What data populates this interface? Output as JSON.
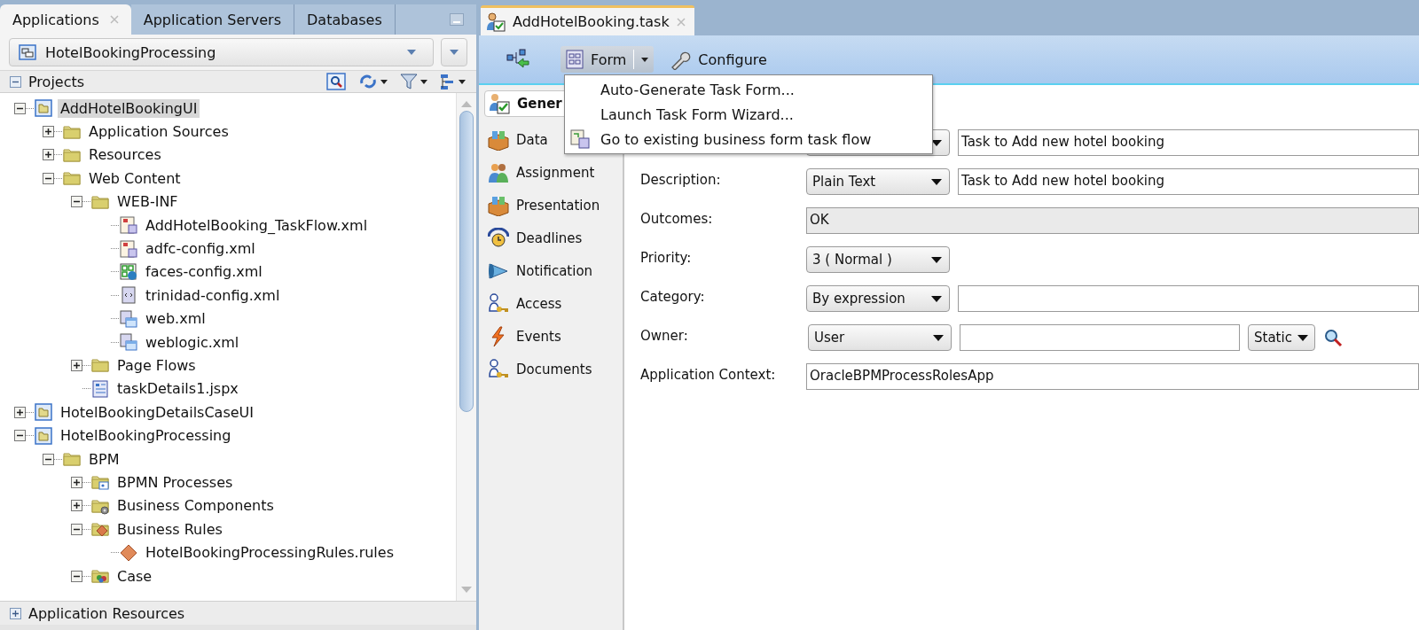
{
  "left_panel": {
    "tabs": [
      {
        "label": "Applications",
        "selected": true,
        "closable": true
      },
      {
        "label": "Application Servers",
        "selected": false,
        "closable": false
      },
      {
        "label": "Databases",
        "selected": false,
        "closable": false
      }
    ],
    "application_selector": {
      "value": "HotelBookingProcessing"
    },
    "projects_header": {
      "title": "Projects",
      "expanded": true
    },
    "tree": [
      {
        "label": "AddHotelBookingUI",
        "kind": "project",
        "expanded": true,
        "selected": true,
        "children": [
          {
            "label": "Application Sources",
            "kind": "folder",
            "expanded": false,
            "selected": false
          },
          {
            "label": "Resources",
            "kind": "folder",
            "expanded": false,
            "selected": false
          },
          {
            "label": "Web Content",
            "kind": "folder",
            "expanded": true,
            "selected": false,
            "children": [
              {
                "label": "WEB-INF",
                "kind": "folder",
                "expanded": true,
                "selected": false,
                "children": [
                  {
                    "label": "AddHotelBooking_TaskFlow.xml",
                    "kind": "taskflow",
                    "selected": false
                  },
                  {
                    "label": "adfc-config.xml",
                    "kind": "taskflow",
                    "selected": false
                  },
                  {
                    "label": "faces-config.xml",
                    "kind": "faces",
                    "selected": false
                  },
                  {
                    "label": "trinidad-config.xml",
                    "kind": "xml",
                    "selected": false
                  },
                  {
                    "label": "web.xml",
                    "kind": "webxml",
                    "selected": false
                  },
                  {
                    "label": "weblogic.xml",
                    "kind": "webxml",
                    "selected": false
                  }
                ]
              },
              {
                "label": "Page Flows",
                "kind": "folder",
                "expanded": false,
                "selected": false
              },
              {
                "label": "taskDetails1.jspx",
                "kind": "jspx",
                "selected": false
              }
            ]
          }
        ]
      },
      {
        "label": "HotelBookingDetailsCaseUI",
        "kind": "project",
        "expanded": false,
        "selected": false
      },
      {
        "label": "HotelBookingProcessing",
        "kind": "project",
        "expanded": true,
        "selected": false,
        "children": [
          {
            "label": "BPM",
            "kind": "folder",
            "expanded": true,
            "selected": false,
            "children": [
              {
                "label": "BPMN Processes",
                "kind": "bpmn-folder",
                "expanded": false,
                "selected": false
              },
              {
                "label": "Business Components",
                "kind": "gear-folder",
                "expanded": false,
                "selected": false
              },
              {
                "label": "Business Rules",
                "kind": "rules-folder",
                "expanded": true,
                "selected": false,
                "children": [
                  {
                    "label": "HotelBookingProcessingRules.rules",
                    "kind": "rules",
                    "selected": false
                  }
                ]
              },
              {
                "label": "Case",
                "kind": "case-folder",
                "expanded": true,
                "selected": false
              }
            ]
          }
        ]
      }
    ],
    "resources_section": {
      "title": "Application Resources",
      "expanded": false
    }
  },
  "editor": {
    "tab": {
      "label": "AddHotelBooking.task",
      "selected": true
    },
    "toolbar": [
      {
        "kind": "icon"
      },
      {
        "kind": "dropdown",
        "label": "Form",
        "pressed": true
      },
      {
        "kind": "button",
        "label": "Configure"
      }
    ],
    "menu": [
      {
        "label": "Auto-Generate Task Form...",
        "has_icon": false
      },
      {
        "label": "Launch Task Form Wizard...",
        "has_icon": false
      },
      {
        "label": "Go to existing business form task flow",
        "has_icon": true
      }
    ],
    "nav": [
      {
        "label": "Gener",
        "kind": "general",
        "selected": true
      },
      {
        "label": "Data",
        "kind": "data",
        "selected": false
      },
      {
        "label": "Assignment",
        "kind": "assignment",
        "selected": false
      },
      {
        "label": "Presentation",
        "kind": "data",
        "selected": false
      },
      {
        "label": "Deadlines",
        "kind": "deadlines",
        "selected": false
      },
      {
        "label": "Notification",
        "kind": "notification",
        "selected": false
      },
      {
        "label": "Access",
        "kind": "access",
        "selected": false
      },
      {
        "label": "Events",
        "kind": "events",
        "selected": false
      },
      {
        "label": "Documents",
        "kind": "access",
        "selected": false
      }
    ],
    "fields": [
      {
        "kind": "select-input",
        "value": "Task to Add new hotel booking"
      },
      {
        "kind": "select-input",
        "label": "Description:",
        "select": "Plain Text",
        "value": "Task to Add new hotel booking"
      },
      {
        "kind": "readonly",
        "label": "Outcomes:",
        "value": "OK"
      },
      {
        "kind": "select",
        "label": "Priority:",
        "select": "3  ( Normal )"
      },
      {
        "kind": "select-input",
        "label": "Category:",
        "select": "By expression"
      },
      {
        "kind": "owner",
        "label": "Owner:",
        "select": "User",
        "mode": "Static"
      },
      {
        "kind": "input",
        "label": "Application Context:",
        "value": "OracleBPMProcessRolesApp"
      }
    ]
  }
}
